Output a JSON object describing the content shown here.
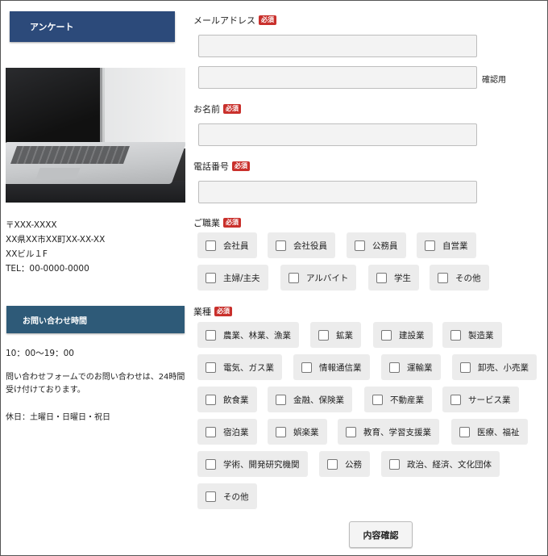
{
  "sidebar": {
    "survey_label": "アンケート",
    "address": [
      "〒XXX-XXXX",
      "XX県XX市XX町XX-XX-XX",
      "XXビル１F",
      "TEL：00-0000-0000"
    ],
    "hours_label": "お問い合わせ時間",
    "hours_time": "10：00〜19：00",
    "hours_note": "問い合わせフォームでのお問い合わせは、24時間受け付けております。",
    "holiday": "休日：土曜日・日曜日・祝日"
  },
  "form": {
    "required_badge": "必須",
    "email_label": "メールアドレス",
    "email_value": "",
    "email_confirm_value": "",
    "confirm_label": "確認用",
    "name_label": "お名前",
    "name_value": "",
    "phone_label": "電話番号",
    "phone_value": "",
    "occupation_label": "ご職業",
    "occupations": [
      "会社員",
      "会社役員",
      "公務員",
      "自営業",
      "主婦/主夫",
      "アルバイト",
      "学生",
      "その他"
    ],
    "industry_label": "業種",
    "industries": [
      "農業、林業、漁業",
      "鉱業",
      "建設業",
      "製造業",
      "電気、ガス業",
      "情報通信業",
      "運輸業",
      "卸売、小売業",
      "飲食業",
      "金融、保険業",
      "不動産業",
      "サービス業",
      "宿泊業",
      "娯楽業",
      "教育、学習支援業",
      "医療、福祉",
      "学術、開発研究機関",
      "公務",
      "政治、経済、文化団体",
      "その他"
    ],
    "submit_label": "内容確認"
  },
  "colors": {
    "survey_button": "#2c4a7a",
    "hours_button": "#2e5a78",
    "required_badge": "#c9302c",
    "checkbox_bg": "#ececec"
  }
}
